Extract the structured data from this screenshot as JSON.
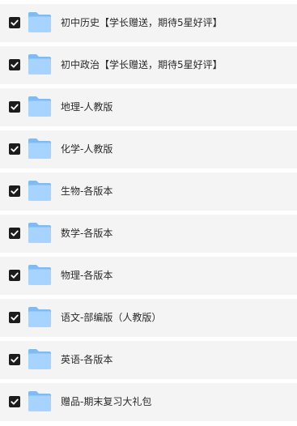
{
  "files": [
    {
      "name": "初中历史【学长赠送，期待5星好评】",
      "checked": true,
      "icon": "folder-icon"
    },
    {
      "name": "初中政治【学长赠送，期待5星好评】",
      "checked": true,
      "icon": "folder-icon"
    },
    {
      "name": "地理-人教版",
      "checked": true,
      "icon": "folder-icon"
    },
    {
      "name": "化学-人教版",
      "checked": true,
      "icon": "folder-icon"
    },
    {
      "name": "生物-各版本",
      "checked": true,
      "icon": "folder-icon"
    },
    {
      "name": "数学-各版本",
      "checked": true,
      "icon": "folder-icon"
    },
    {
      "name": "物理-各版本",
      "checked": true,
      "icon": "folder-icon"
    },
    {
      "name": "语文-部编版（人教版）",
      "checked": true,
      "icon": "folder-icon"
    },
    {
      "name": "英语-各版本",
      "checked": true,
      "icon": "folder-icon"
    },
    {
      "name": "赠品-期末复习大礼包",
      "checked": true,
      "icon": "folder-icon"
    }
  ],
  "colors": {
    "row_background": "#f4f4f4",
    "checkbox": "#1c1c1c",
    "folder_light": "#a6d3ff",
    "folder_dark": "#7dbcf7",
    "text": "#2b2b2b"
  }
}
